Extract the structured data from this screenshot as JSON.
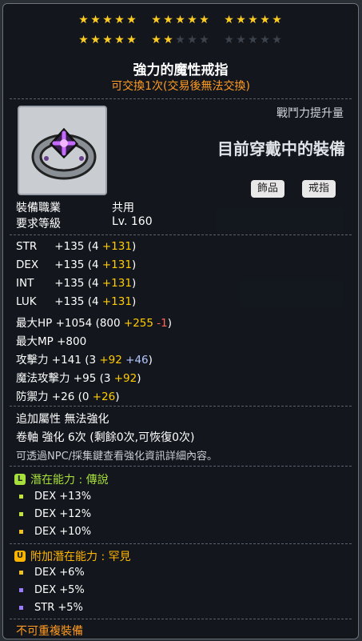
{
  "stars": {
    "groups": [
      {
        "lit": 5,
        "total": 5
      },
      {
        "lit": 5,
        "total": 5
      },
      {
        "lit": 5,
        "total": 5
      },
      {
        "lit": 5,
        "total": 5
      },
      {
        "lit": 2,
        "total": 5
      },
      {
        "lit": 0,
        "total": 5
      }
    ],
    "lit_color": "#ffcc22",
    "off_color": "#3d434c"
  },
  "item": {
    "name": "強力的魔性戒指",
    "trade_note": "可交換1次(交易後無法交換)",
    "icon": "purple-cross-ring-icon",
    "power_label": "戰鬥力提升量",
    "equipped_label": "目前穿戴中的裝備",
    "category": "飾品",
    "type": "戒指"
  },
  "requirements": {
    "job_label": "裝備職業",
    "job_value": "共用",
    "level_label": "要求等級",
    "level_value": "Lv. 160"
  },
  "stats": [
    {
      "name": "STR",
      "total": "+135",
      "base": "(4",
      "bonus": "+131",
      "close": ")"
    },
    {
      "name": "DEX",
      "total": "+135",
      "base": "(4",
      "bonus": "+131",
      "close": ")"
    },
    {
      "name": "INT",
      "total": "+135",
      "base": "(4",
      "bonus": "+131",
      "close": ")"
    },
    {
      "name": "LUK",
      "total": "+135",
      "base": "(4",
      "bonus": "+131",
      "close": ")"
    }
  ],
  "max_hp": {
    "name": "最大HP",
    "total": "+1054",
    "base": "(800",
    "bonus": "+255",
    "minus": "-1",
    "close": ")"
  },
  "max_mp": {
    "name": "最大MP",
    "total": "+800"
  },
  "attack": {
    "name": "攻擊力",
    "total": "+141",
    "base": "(3",
    "bonus": "+92",
    "extra": "+46",
    "close": ")"
  },
  "magic_attack": {
    "name": "魔法攻擊力",
    "total": "+95",
    "base": "(3",
    "bonus": "+92",
    "close": ")"
  },
  "defense": {
    "name": "防禦力",
    "total": "+26",
    "base": "(0",
    "bonus": "+26",
    "close": ")"
  },
  "extra": {
    "additional_attr": "追加屬性 無法強化",
    "scroll": "卷軸 強化 6次 (剩餘0次,可恢復0次)",
    "npc_note": "可透過NPC/採集鍵查看強化資訊詳細內容。"
  },
  "potential": {
    "icon_letter": "L",
    "label": "潛在能力 : 傳說",
    "color": "#a7e03a",
    "lines": [
      "DEX +13%",
      "DEX +12%",
      "DEX +10%"
    ],
    "bullet_colors": [
      "#c7e23a",
      "#c7e23a",
      "#f0c020"
    ]
  },
  "additional_potential": {
    "icon_letter": "U",
    "label": "附加潛在能力 : 罕見",
    "color": "#ffb400",
    "lines": [
      "DEX +6%",
      "DEX +5%",
      "STR +5%"
    ],
    "bullet_colors": [
      "#f0c020",
      "#9a7cff",
      "#9a7cff"
    ]
  },
  "footer": {
    "note": "不可重複裝備",
    "color": "#ff9a22"
  }
}
